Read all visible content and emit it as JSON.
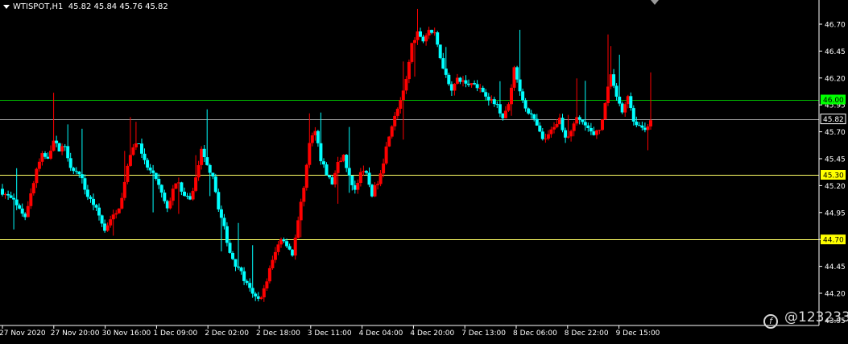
{
  "header": {
    "symbol": "WTISPOT,H1",
    "ohlc": "45.82 45.84 45.76 45.82"
  },
  "watermark": {
    "text": "@123233"
  },
  "colors": {
    "background": "#000000",
    "bull": "#ff0000",
    "bear": "#00ffff",
    "axis": "#ffffff",
    "green_line": "#00c000",
    "yellow_line": "#ffff66",
    "price_line": "#a0a0a0"
  },
  "chart_data": {
    "type": "candlestick",
    "symbol": "WTISPOT",
    "timeframe": "H1",
    "ylim": [
      44.05,
      46.82
    ],
    "y_ticks": [
      46.7,
      46.45,
      46.2,
      45.95,
      45.7,
      45.45,
      45.2,
      44.95,
      44.7,
      44.45,
      44.2,
      43.95
    ],
    "x_ticks": [
      "27 Nov 2020",
      "27 Nov 20:00",
      "30 Nov 16:00",
      "1 Dec 09:00",
      "2 Dec 02:00",
      "2 Dec 18:00",
      "3 Dec 11:00",
      "4 Dec 04:00",
      "4 Dec 20:00",
      "7 Dec 13:00",
      "8 Dec 06:00",
      "8 Dec 22:00",
      "9 Dec 15:00"
    ],
    "levels": [
      {
        "value": 46.0,
        "label": "46.00",
        "color": "#00c000"
      },
      {
        "value": 45.3,
        "label": "45.30",
        "color": "#ffff66"
      },
      {
        "value": 44.7,
        "label": "44.70",
        "color": "#ffff66"
      }
    ],
    "current_price": {
      "value": 45.82,
      "label": "45.82"
    },
    "close_path": [
      45.14,
      45.1,
      45.05,
      44.97,
      44.93,
      45.12,
      45.35,
      45.48,
      45.47,
      45.62,
      45.53,
      45.58,
      45.38,
      45.32,
      45.25,
      45.1,
      45.03,
      44.92,
      44.78,
      44.9,
      44.93,
      45.08,
      45.37,
      45.57,
      45.6,
      45.42,
      45.33,
      45.27,
      45.12,
      44.97,
      45.18,
      45.22,
      45.1,
      45.06,
      45.27,
      45.52,
      45.38,
      45.3,
      45.0,
      44.8,
      44.58,
      44.47,
      44.38,
      44.28,
      44.18,
      44.14,
      44.23,
      44.42,
      44.58,
      44.72,
      44.66,
      44.56,
      44.86,
      45.2,
      45.58,
      45.73,
      45.45,
      45.3,
      45.22,
      45.4,
      45.47,
      45.28,
      45.16,
      45.33,
      45.3,
      45.12,
      45.24,
      45.43,
      45.68,
      45.86,
      46.0,
      46.18,
      46.52,
      46.63,
      46.55,
      46.65,
      46.6,
      46.4,
      46.22,
      46.1,
      46.18,
      46.17,
      46.14,
      46.16,
      46.1,
      46.05,
      45.98,
      45.95,
      45.84,
      45.96,
      46.28,
      46.08,
      45.93,
      45.85,
      45.75,
      45.62,
      45.66,
      45.76,
      45.82,
      45.66,
      45.7,
      45.82,
      45.79,
      45.73,
      45.66,
      45.72,
      45.95,
      46.25,
      46.04,
      45.88,
      46.05,
      45.8,
      45.76,
      45.72,
      45.82
    ]
  }
}
